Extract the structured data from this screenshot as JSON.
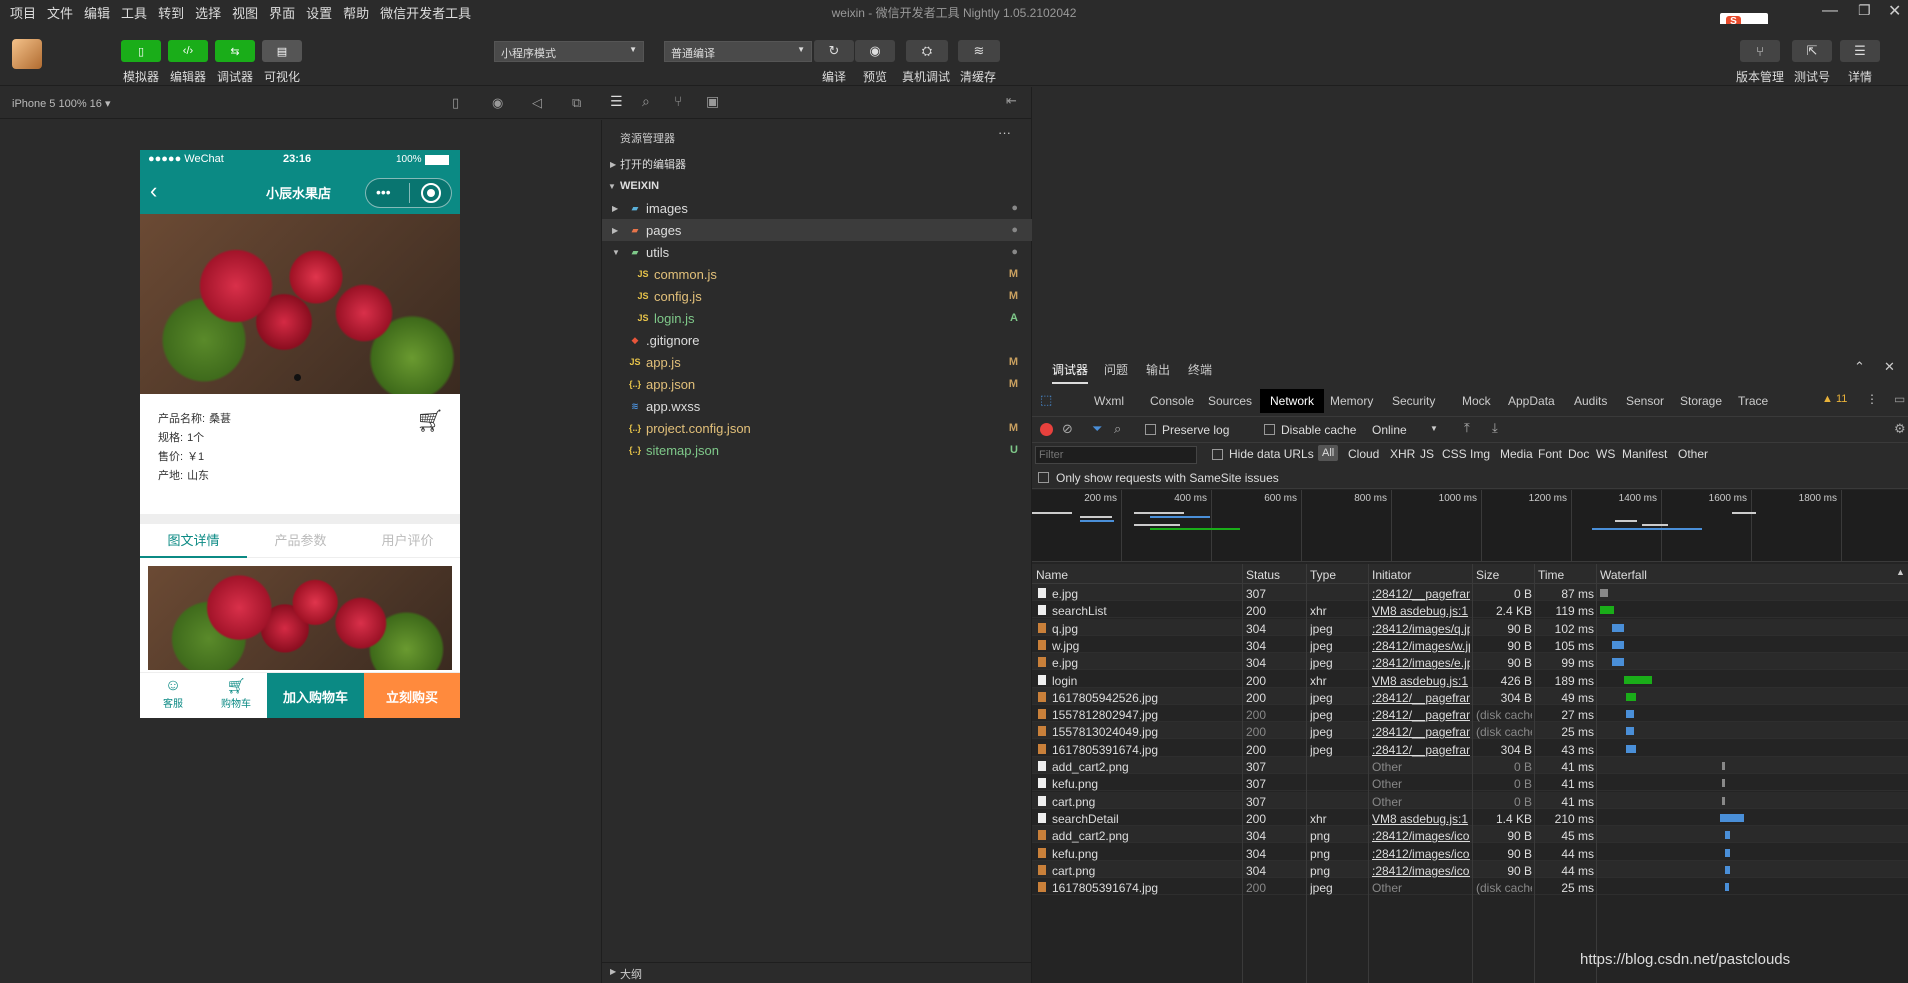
{
  "menu": [
    "项目",
    "文件",
    "编辑",
    "工具",
    "转到",
    "选择",
    "视图",
    "界面",
    "设置",
    "帮助",
    "微信开发者工具"
  ],
  "window_title": "weixin - 微信开发者工具 Nightly 1.05.2102042",
  "toolbar": {
    "left_buttons": [
      {
        "label": "模拟器",
        "icon": "phone-icon"
      },
      {
        "label": "编辑器",
        "icon": "code-icon"
      },
      {
        "label": "调试器",
        "icon": "debug-icon"
      },
      {
        "label": "可视化",
        "icon": "visual-icon"
      }
    ],
    "mode_select": "小程序模式",
    "compile_select": "普通编译",
    "center_buttons": [
      {
        "label": "编译",
        "icon": "refresh-icon"
      },
      {
        "label": "预览",
        "icon": "eye-icon"
      },
      {
        "label": "真机调试",
        "icon": "bug-icon"
      },
      {
        "label": "清缓存",
        "icon": "layers-icon"
      }
    ],
    "right_buttons": [
      {
        "label": "版本管理",
        "icon": "branch-icon"
      },
      {
        "label": "测试号",
        "icon": "external-icon"
      },
      {
        "label": "详情",
        "icon": "menu-icon"
      }
    ]
  },
  "simulator": {
    "device": "iPhone 5 100% 16 ▾"
  },
  "phone": {
    "carrier": "●●●●● WeChat",
    "time": "23:16",
    "battery": "100%",
    "nav_title": "小辰水果店",
    "info": [
      {
        "label": "产品名称:",
        "value": "桑葚"
      },
      {
        "label": "规格:",
        "value": "1个"
      },
      {
        "label": "售价:",
        "value": "￥1"
      },
      {
        "label": "产地:",
        "value": "山东"
      }
    ],
    "tabs": [
      "图文详情",
      "产品参数",
      "用户评价"
    ],
    "bottom": {
      "kefu": "客服",
      "cart": "购物车",
      "add_cart": "加入购物车",
      "buy_now": "立刻购买"
    }
  },
  "explorer": {
    "title": "资源管理器",
    "more": "···",
    "open_editors": "打开的编辑器",
    "root": "WEIXIN",
    "files": [
      {
        "name": "images",
        "type": "folder",
        "status": "●",
        "depth": 1,
        "color": "#ddd",
        "icon": "folder-images-icon"
      },
      {
        "name": "pages",
        "type": "folder",
        "status": "●",
        "depth": 1,
        "color": "#ddd",
        "icon": "folder-pages-icon"
      },
      {
        "name": "utils",
        "type": "folder-open",
        "status": "●",
        "depth": 1,
        "color": "#ddd",
        "icon": "folder-utils-icon"
      },
      {
        "name": "common.js",
        "type": "js",
        "status": "M",
        "depth": 2,
        "color": "#e2c07a",
        "icon": "js-file-icon"
      },
      {
        "name": "config.js",
        "type": "js",
        "status": "M",
        "depth": 2,
        "color": "#e2c07a",
        "icon": "js-file-icon"
      },
      {
        "name": "login.js",
        "type": "js",
        "status": "A",
        "depth": 2,
        "color": "#7fc98a",
        "icon": "js-file-icon"
      },
      {
        "name": ".gitignore",
        "type": "git",
        "status": "",
        "depth": 1,
        "color": "#ddd",
        "icon": "git-icon"
      },
      {
        "name": "app.js",
        "type": "js",
        "status": "M",
        "depth": 1,
        "color": "#e2c07a",
        "icon": "js-file-icon"
      },
      {
        "name": "app.json",
        "type": "json",
        "status": "M",
        "depth": 1,
        "color": "#e2c07a",
        "icon": "json-file-icon"
      },
      {
        "name": "app.wxss",
        "type": "css",
        "status": "",
        "depth": 1,
        "color": "#ddd",
        "icon": "wxss-file-icon"
      },
      {
        "name": "project.config.json",
        "type": "json",
        "status": "M",
        "depth": 1,
        "color": "#e2c07a",
        "icon": "json-file-icon"
      },
      {
        "name": "sitemap.json",
        "type": "json",
        "status": "U",
        "depth": 1,
        "color": "#7fc98a",
        "icon": "json-file-icon"
      }
    ],
    "outline": "大纲"
  },
  "devtools": {
    "top_tabs": [
      "调试器",
      "问题",
      "输出",
      "终端"
    ],
    "panel_tabs": [
      "Wxml",
      "Console",
      "Sources",
      "Network",
      "Memory",
      "Security",
      "Mock",
      "AppData",
      "Audits",
      "Sensor",
      "Storage",
      "Trace"
    ],
    "active_panel": "Network",
    "warnings": "▲ 11",
    "preserve_log": "Preserve log",
    "disable_cache": "Disable cache",
    "throttle": "Online",
    "filter_placeholder": "Filter",
    "hide_data_urls": "Hide data URLs",
    "all": "All",
    "filter_types": [
      "Cloud",
      "XHR",
      "JS",
      "CSS",
      "Img",
      "Media",
      "Font",
      "Doc",
      "WS",
      "Manifest",
      "Other"
    ],
    "samesite": "Only show requests with SameSite issues",
    "timeline_ticks": [
      "200 ms",
      "400 ms",
      "600 ms",
      "800 ms",
      "1000 ms",
      "1200 ms",
      "1400 ms",
      "1600 ms",
      "1800 ms",
      "200"
    ],
    "columns": [
      "Name",
      "Status",
      "Type",
      "Initiator",
      "Size",
      "Time",
      "Waterfall"
    ],
    "rows": [
      {
        "name": "e.jpg",
        "status": "307",
        "type": "",
        "initiator": ":28412/__pageframe...",
        "size": "0 B",
        "time": "87 ms"
      },
      {
        "name": "searchList",
        "status": "200",
        "type": "xhr",
        "initiator": "VM8 asdebug.js:1",
        "size": "2.4 KB",
        "time": "119 ms"
      },
      {
        "name": "q.jpg",
        "status": "304",
        "type": "jpeg",
        "initiator": ":28412/images/q.jpg",
        "size": "90 B",
        "time": "102 ms"
      },
      {
        "name": "w.jpg",
        "status": "304",
        "type": "jpeg",
        "initiator": ":28412/images/w.jpg",
        "size": "90 B",
        "time": "105 ms"
      },
      {
        "name": "e.jpg",
        "status": "304",
        "type": "jpeg",
        "initiator": ":28412/images/e.jpg",
        "size": "90 B",
        "time": "99 ms"
      },
      {
        "name": "login",
        "status": "200",
        "type": "xhr",
        "initiator": "VM8 asdebug.js:1",
        "size": "426 B",
        "time": "189 ms"
      },
      {
        "name": "1617805942526.jpg",
        "status": "200",
        "type": "jpeg",
        "initiator": ":28412/__pageframe...",
        "size": "304 B",
        "time": "49 ms"
      },
      {
        "name": "1557812802947.jpg",
        "status": "200",
        "type": "jpeg",
        "initiator": ":28412/__pageframe...",
        "size": "(disk cache)",
        "time": "27 ms"
      },
      {
        "name": "1557813024049.jpg",
        "status": "200",
        "type": "jpeg",
        "initiator": ":28412/__pageframe...",
        "size": "(disk cache)",
        "time": "25 ms"
      },
      {
        "name": "1617805391674.jpg",
        "status": "200",
        "type": "jpeg",
        "initiator": ":28412/__pageframe...",
        "size": "304 B",
        "time": "43 ms"
      },
      {
        "name": "add_cart2.png",
        "status": "307",
        "type": "",
        "initiator": "Other",
        "size": "0 B",
        "time": "41 ms"
      },
      {
        "name": "kefu.png",
        "status": "307",
        "type": "",
        "initiator": "Other",
        "size": "0 B",
        "time": "41 ms"
      },
      {
        "name": "cart.png",
        "status": "307",
        "type": "",
        "initiator": "Other",
        "size": "0 B",
        "time": "41 ms"
      },
      {
        "name": "searchDetail",
        "status": "200",
        "type": "xhr",
        "initiator": "VM8 asdebug.js:1",
        "size": "1.4 KB",
        "time": "210 ms"
      },
      {
        "name": "add_cart2.png",
        "status": "304",
        "type": "png",
        "initiator": ":28412/images/icon...",
        "size": "90 B",
        "time": "45 ms"
      },
      {
        "name": "kefu.png",
        "status": "304",
        "type": "png",
        "initiator": ":28412/images/icon...",
        "size": "90 B",
        "time": "44 ms"
      },
      {
        "name": "cart.png",
        "status": "304",
        "type": "png",
        "initiator": ":28412/images/icon...",
        "size": "90 B",
        "time": "44 ms"
      },
      {
        "name": "1617805391674.jpg",
        "status": "200",
        "type": "jpeg",
        "initiator": "Other",
        "size": "(disk cache)",
        "time": "25 ms"
      }
    ],
    "watermark": "https://blog.csdn.net/pastclouds"
  },
  "colors": {
    "accent": "#0b8a84",
    "green_btn": "#1aad19",
    "orange": "#ff8a3d"
  }
}
